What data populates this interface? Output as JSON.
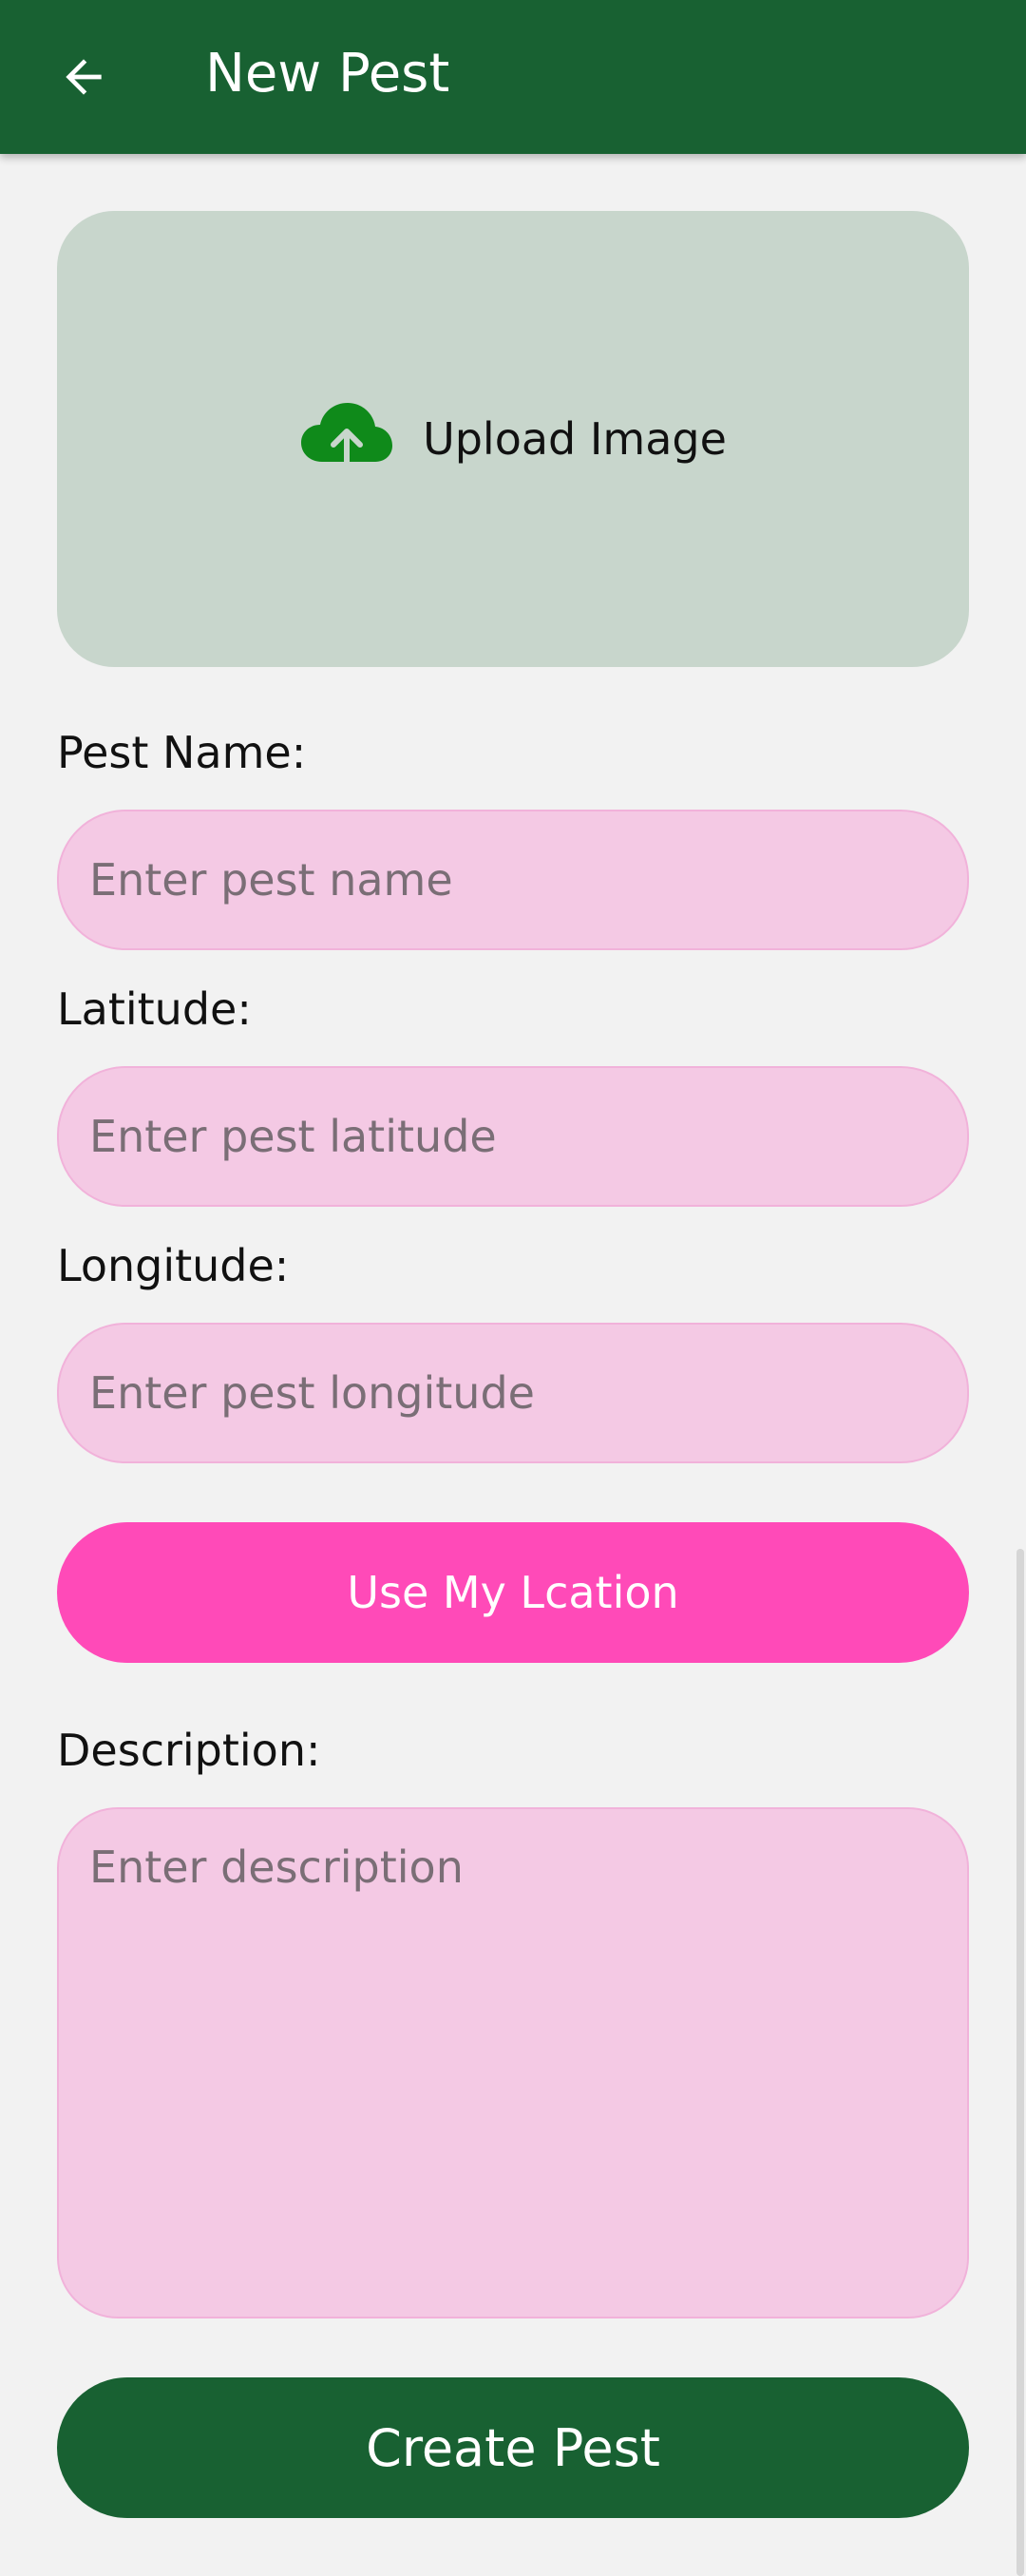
{
  "appbar": {
    "title": "New Pest",
    "back_icon": "arrow-left-icon",
    "color": "#186132"
  },
  "upload": {
    "label": "Upload Image",
    "icon": "cloud-upload-icon",
    "icon_color": "#0f8a1a"
  },
  "form": {
    "pest_name": {
      "label": "Pest Name:",
      "placeholder": "Enter pest name",
      "value": ""
    },
    "latitude": {
      "label": "Latitude:",
      "placeholder": "Enter pest latitude",
      "value": ""
    },
    "longitude": {
      "label": "Longitude:",
      "placeholder": "Enter pest longitude",
      "value": ""
    },
    "use_location_label": "Use My Lcation",
    "description": {
      "label": "Description:",
      "placeholder": "Enter description",
      "value": ""
    },
    "create_label": "Create Pest"
  },
  "colors": {
    "accent_pink": "#ff4ab8",
    "input_bg": "#f4c9e4",
    "upload_bg": "#c8d6cc"
  }
}
